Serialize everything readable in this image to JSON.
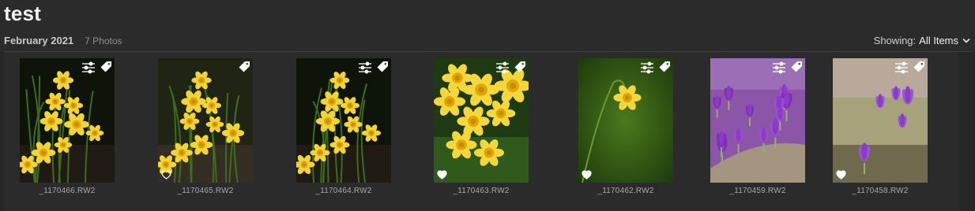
{
  "album": {
    "title": "test"
  },
  "section": {
    "date": "February 2021",
    "count": "7 Photos"
  },
  "filter": {
    "label": "Showing:",
    "value": "All Items"
  },
  "photos": [
    {
      "filename": "_1170466.RW2",
      "favorite": false,
      "edited": true,
      "tagged": true,
      "theme": "dark-daffodils"
    },
    {
      "filename": "_1170465.RW2",
      "favorite": true,
      "favorite_style": "outline",
      "edited": false,
      "tagged": true,
      "theme": "dark-daffodils-warm"
    },
    {
      "filename": "_1170464.RW2",
      "favorite": false,
      "edited": true,
      "tagged": true,
      "theme": "dark-daffodils"
    },
    {
      "filename": "_1170463.RW2",
      "favorite": true,
      "favorite_style": "filled",
      "edited": true,
      "tagged": true,
      "theme": "daffodil-closeup"
    },
    {
      "filename": "_1170462.RW2",
      "favorite": true,
      "favorite_style": "filled",
      "edited": true,
      "tagged": true,
      "theme": "single-daffodil-green"
    },
    {
      "filename": "_1170459.RW2",
      "favorite": false,
      "edited": true,
      "tagged": true,
      "theme": "purple-crocus-dense"
    },
    {
      "filename": "_1170458.RW2",
      "favorite": true,
      "favorite_style": "filled",
      "edited": true,
      "tagged": true,
      "theme": "purple-crocus-soft"
    }
  ],
  "icons": {
    "edit": "adjustments-sliders-icon",
    "tag": "tag-icon",
    "favorite": "heart-icon",
    "dropdown": "chevron-down-icon"
  }
}
